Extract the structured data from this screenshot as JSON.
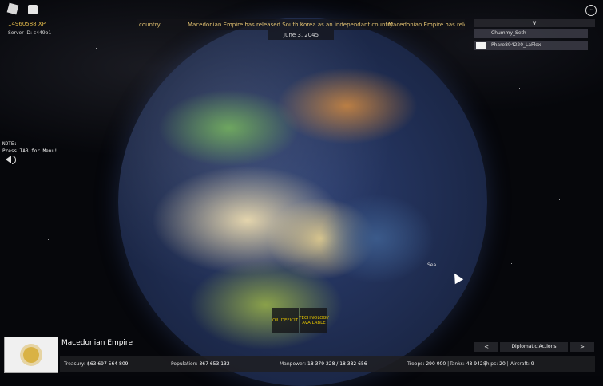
{
  "hud": {
    "xp": "14960588 XP",
    "server_id": "Server ID: c449b1",
    "date": "June 3, 2045",
    "note_line1": "NOTE:",
    "note_line2": "Press TAB for Menu!"
  },
  "ticker": {
    "items": [
      "country",
      "Macedonian Empire has released South Korea as an independant country",
      "Macedonian Empire has releasec"
    ]
  },
  "players": {
    "toggle": "v",
    "list": [
      "Chummy_Seth",
      "Phare894220_LaFlex"
    ]
  },
  "map": {
    "label": "Sea"
  },
  "alerts": [
    "OIL DEFICIT",
    "TECHNOLOGY AVAILABLE"
  ],
  "nation": {
    "name": "Macedonian Empire",
    "treasury_label": "Treasury:",
    "treasury": "$63 697 564 809",
    "population_label": "Population:",
    "population": "367 653 132",
    "manpower_label": "Manpower:",
    "manpower": "18 379 228 / 18 382 656",
    "troops_label": "Troops:",
    "troops": "290 000",
    "tanks_label": "Tanks:",
    "tanks": "48 942",
    "ships_label": "Ships:",
    "ships": "20",
    "aircraft_label": "Aircraft:",
    "aircraft": "9"
  },
  "diplomacy": {
    "prev": "<",
    "label": "Diplomatic Actions",
    "next": ">"
  },
  "colors": {
    "accent": "#e0c070",
    "alert": "#e0c000",
    "panel": "#1e1e22"
  }
}
